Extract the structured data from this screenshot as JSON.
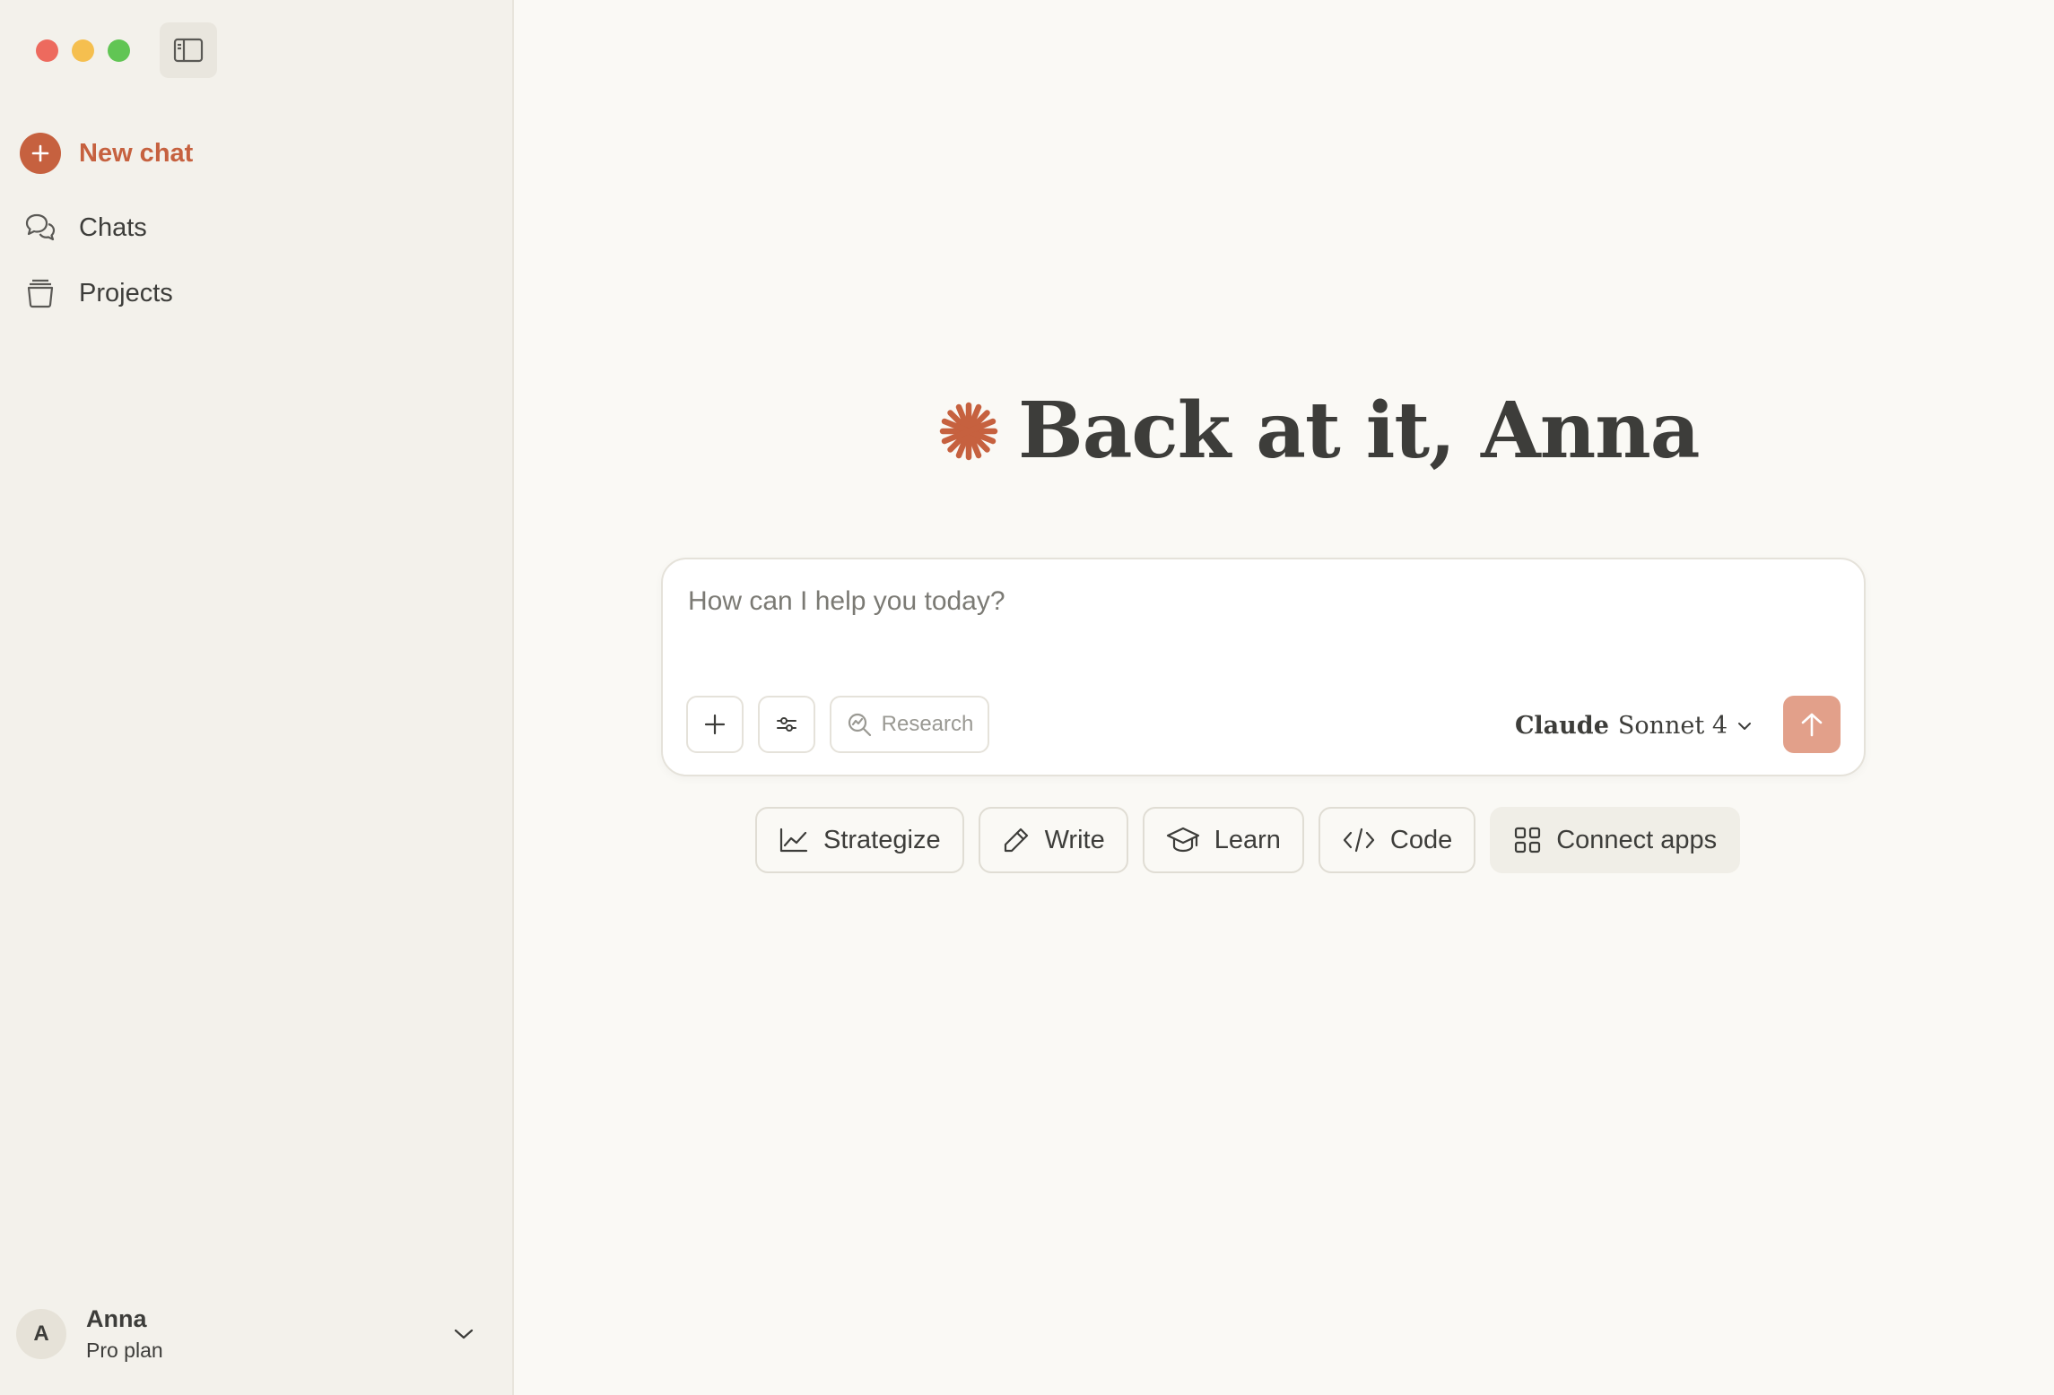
{
  "sidebar": {
    "new_chat_label": "New chat",
    "items": [
      {
        "label": "Chats",
        "icon": "chat-bubbles-icon"
      },
      {
        "label": "Projects",
        "icon": "projects-icon"
      }
    ],
    "user": {
      "initial": "A",
      "name": "Anna",
      "plan": "Pro plan"
    }
  },
  "main": {
    "greeting": "Back at it, Anna",
    "composer": {
      "placeholder": "How can I help you today?",
      "research_label": "Research",
      "model_brand": "Claude",
      "model_name": "Sonnet 4"
    },
    "chips": [
      {
        "label": "Strategize",
        "icon": "chart-line-icon"
      },
      {
        "label": "Write",
        "icon": "pencil-icon"
      },
      {
        "label": "Learn",
        "icon": "graduation-cap-icon"
      },
      {
        "label": "Code",
        "icon": "code-icon"
      },
      {
        "label": "Connect apps",
        "icon": "grid-icon"
      }
    ]
  },
  "colors": {
    "accent": "#c6613f",
    "send_button": "#e2a08a",
    "background": "#faf9f5",
    "sidebar_background": "#f3f1eb"
  }
}
